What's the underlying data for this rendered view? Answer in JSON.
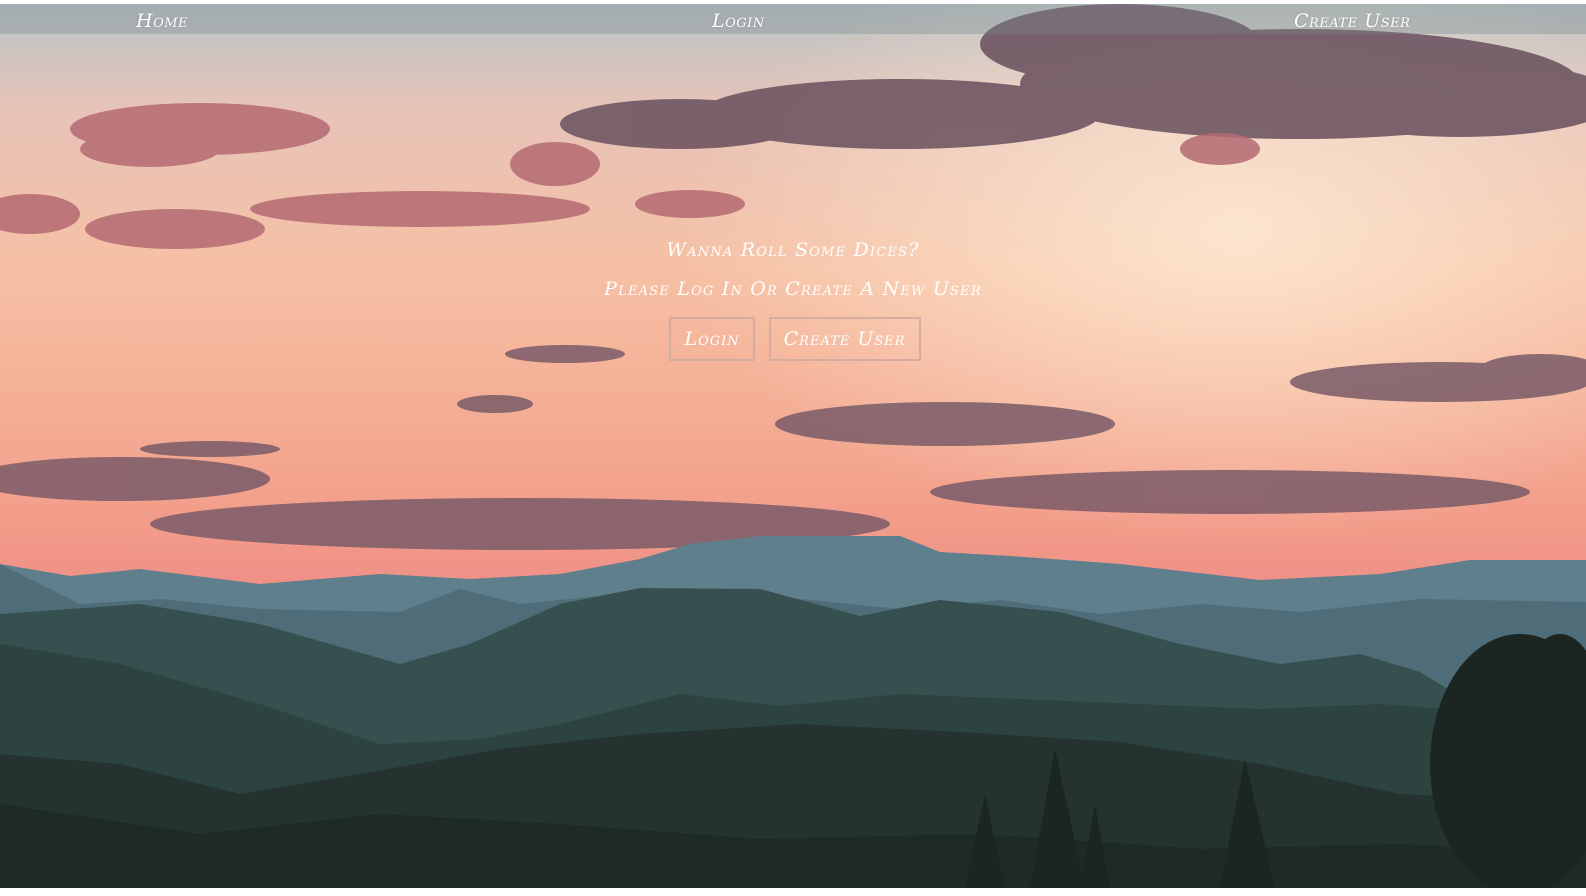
{
  "nav": {
    "home": "Home",
    "login": "Login",
    "create_user": "Create User"
  },
  "hero": {
    "title": "Wanna Roll Some Dices?",
    "subtitle": "Please Log In Or Create A New User",
    "login_button": "Login",
    "create_user_button": "Create User"
  },
  "colors": {
    "text": "#ffffff",
    "navbar_overlay": "rgba(120,135,140,0.35)",
    "button_border": "#d2aaa0"
  }
}
